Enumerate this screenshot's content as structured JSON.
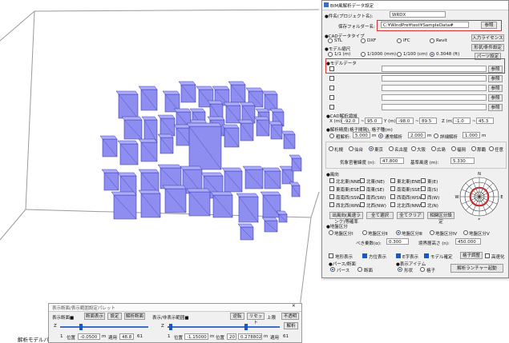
{
  "dialog": {
    "title": "BIM風解析データ設定",
    "case_name_label": "●件名(プロジェクト名):",
    "case_name_value": "WRDX",
    "save_folder_label": "保存フォルダー名:",
    "save_folder_value": "C:¥WindPre¥test¥SampleData#",
    "browse": "参照",
    "cad_type_label": "●CADデータタイプ",
    "cad_types": [
      "STL",
      "DXF",
      "IFC",
      "Revit"
    ],
    "import_license_btn": "入力ライセンス",
    "scale_label": "●モデル縮尺",
    "scales": [
      "1/1 (m)",
      "1/1000 (mm)",
      "1/100 (cm)",
      "0.3048 (ft)"
    ],
    "shape_condition_btn": "形状/条件設定",
    "parts_setting_btn": "パーツ設定",
    "model_data_label": "●モデルデータ",
    "model_rows": [
      {
        "value": ""
      },
      {
        "value": ""
      },
      {
        "value": ""
      },
      {
        "value": ""
      },
      {
        "value": ""
      }
    ],
    "cad_region_label": "●CAD解析領域",
    "region": {
      "x_label": "X (m):",
      "x_min": "-92.0",
      "x_max": "95.0",
      "y_label": "Y (m):",
      "y_min": "-98.0",
      "y_max": "89.5",
      "z_label": "Z (m):",
      "z_min": "-1.0",
      "z_max": "45.3"
    },
    "resolution_label": "●解析精度(格子間隔), 格子種(m)",
    "res_options": [
      "粗解析:",
      "通常解析",
      "詳細解析"
    ],
    "res_values": [
      "5.000",
      "2.000",
      "1.000"
    ],
    "res_unit": "m",
    "cities": [
      "札幌",
      "仙台",
      "東京",
      "名古屋",
      "大阪",
      "広島",
      "福岡",
      "那覇",
      "任意"
    ],
    "temp_label": "気象官署緯度 (n):",
    "temp_value": "47.800",
    "ref_label": "基準風速 (m):",
    "ref_value": "5.330",
    "wind_dir_label": "●風向",
    "wind_dirs": [
      "北北東(NNE)",
      "北東(NE)",
      "東北東(ENE)",
      "東(E)",
      "東南東(ESE)",
      "南東(SE)",
      "南南東(SSE)",
      "南(S)",
      "南南西(SSW)",
      "南西(SW)",
      "西南西(WSW)",
      "西(W)",
      "西北西(WNW)",
      "北西(NW)",
      "北北西(NNW)",
      "北(N)"
    ],
    "all_select": "全て選択",
    "all_clear": "全てクリア",
    "special_label": "出風向(風速ランク)等確率",
    "detail_setting": "相関区分設定",
    "compass": [
      "N",
      "E",
      "S",
      "W"
    ],
    "ground_label": "●地盤区分",
    "ground_options": [
      "地盤区分Ⅰ",
      "地盤区分Ⅱ",
      "地盤区分Ⅲ",
      "地盤区分Ⅳ",
      "地盤区分Ⅴ"
    ],
    "power_label": "べき乗数(α):",
    "power_value": "0.300",
    "height_label": "境界層高さ (n):",
    "height_value": "450.000",
    "checks": [
      "地形表示",
      "方位表示",
      "E字表示",
      "モデル確定"
    ],
    "grid_adjust": "格子調整",
    "high_speed": "高速化",
    "pass_label": "●パース/断面",
    "pass_options": [
      "パース",
      "断面"
    ],
    "disp_label": "●表示アイテム",
    "disp_options": [
      "形状",
      "格子"
    ],
    "launch_btn": "解析ランチャー起動"
  },
  "palette": {
    "title": "表示断面/表示範囲設定パレット",
    "left_group_label": "表示断面■",
    "left_buttons": [
      "断面表示",
      "設定",
      "解析断面"
    ],
    "right_group_label": "表示/非表示範囲■",
    "right_buttons": [
      "下限",
      "逆転",
      "リセット",
      "上限",
      "不透明"
    ],
    "z_label": "Z",
    "left_fields": [
      "1",
      "位置",
      "-0.0500",
      "m",
      "適用",
      "48.8",
      "61"
    ],
    "right_fields": [
      "1",
      "位置",
      "-1.15000",
      "m",
      "位置",
      "20",
      "0.278802",
      "m",
      "適用",
      "61"
    ],
    "extra_btn": "解析"
  },
  "taskbar_label": "解析モデルパ"
}
